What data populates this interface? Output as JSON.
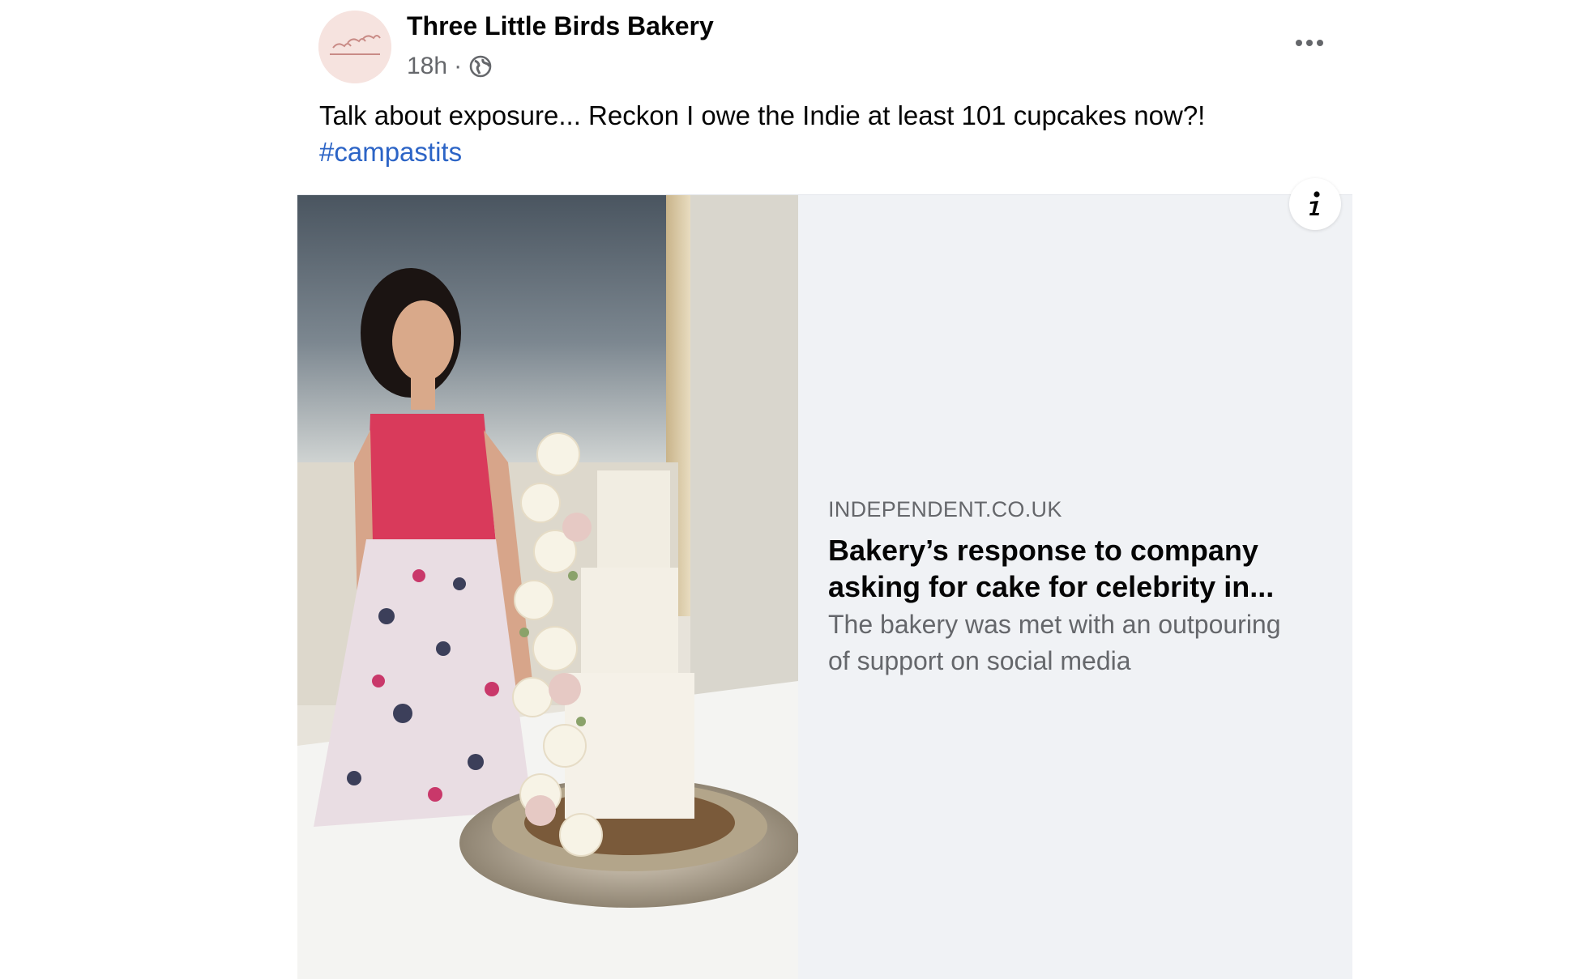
{
  "post": {
    "author": "Three Little Birds Bakery",
    "timestamp": "18h",
    "separator": "·",
    "audience_icon": "globe-icon",
    "text_line1": "Talk about exposure... Reckon I owe the Indie at least 101 cupcakes now?!",
    "hashtag": "#campastits"
  },
  "link_card": {
    "source": "INDEPENDENT.CO.UK",
    "headline_line1": "Bakery’s response to company",
    "headline_line2": "asking for cake for celebrity in...",
    "description_line1": "The bakery was met with an outpouring",
    "description_line2": "of support on social media",
    "info_icon": "info-icon"
  },
  "colors": {
    "hashtag": "#2c64c6",
    "secondary_text": "#65676b",
    "card_background": "#f0f2f5"
  }
}
